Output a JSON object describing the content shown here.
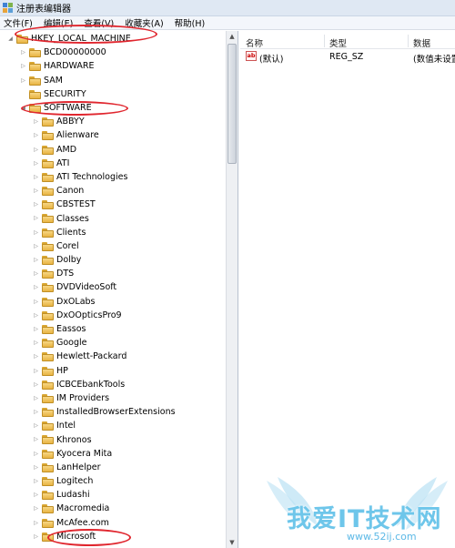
{
  "window": {
    "title": "注册表编辑器",
    "app_icon": "registry-icon"
  },
  "menu": [
    "文件(F)",
    "编辑(E)",
    "查看(V)",
    "收藏夹(A)",
    "帮助(H)"
  ],
  "tree": {
    "root": {
      "label": "HKEY_LOCAL_MACHINE",
      "expanded": true
    },
    "level1": [
      {
        "label": "BCD00000000",
        "expandable": true
      },
      {
        "label": "HARDWARE",
        "expandable": true
      },
      {
        "label": "SAM",
        "expandable": true
      },
      {
        "label": "SECURITY",
        "expandable": false
      },
      {
        "label": "SOFTWARE",
        "expandable": true,
        "expanded": true
      }
    ],
    "software_children": [
      "ABBYY",
      "Alienware",
      "AMD",
      "ATI",
      "ATI Technologies",
      "Canon",
      "CBSTEST",
      "Classes",
      "Clients",
      "Corel",
      "Dolby",
      "DTS",
      "DVDVideoSoft",
      "DxOLabs",
      "DxOOpticsPro9",
      "Eassos",
      "Google",
      "Hewlett-Packard",
      "HP",
      "ICBCEbankTools",
      "IM Providers",
      "InstalledBrowserExtensions",
      "Intel",
      "Khronos",
      "Kyocera Mita",
      "LanHelper",
      "Logitech",
      "Ludashi",
      "Macromedia",
      "McAfee.com",
      "Microsoft"
    ]
  },
  "values": {
    "columns": {
      "name": "名称",
      "type": "类型",
      "data": "数据"
    },
    "rows": [
      {
        "icon": "string-value-icon",
        "icon_text": "ab",
        "name": "(默认)",
        "type": "REG_SZ",
        "data": "(数值未设置)"
      }
    ]
  },
  "watermark": {
    "text": "我爱IT技术网",
    "url": "www.52ij.com"
  },
  "colors": {
    "annotation": "#e0262e",
    "folder": "#e8b443",
    "titlebar": "#dfe8f3"
  }
}
